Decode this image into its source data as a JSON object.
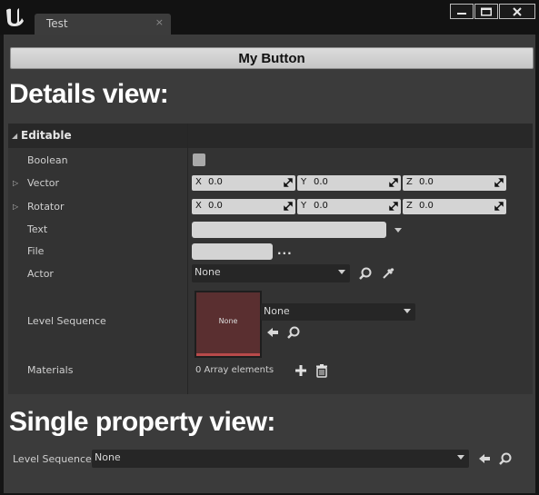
{
  "window": {
    "tab_title": "Test",
    "tab_close": "×"
  },
  "toolbar": {
    "my_button_label": "My Button"
  },
  "headings": {
    "details_view": "Details view:",
    "single_property_view": "Single property view:"
  },
  "details": {
    "category": "Editable",
    "rows": {
      "boolean": "Boolean",
      "vector": "Vector",
      "rotator": "Rotator",
      "text": "Text",
      "file": "File",
      "actor": "Actor",
      "level_sequence": "Level Sequence",
      "materials": "Materials"
    },
    "vector": {
      "x_axis": "X",
      "x_value": "0.0",
      "y_axis": "Y",
      "y_value": "0.0",
      "z_axis": "Z",
      "z_value": "0.0"
    },
    "rotator": {
      "x_axis": "X",
      "x_value": "0.0",
      "y_axis": "Y",
      "y_value": "0.0",
      "z_axis": "Z",
      "z_value": "0.0"
    },
    "file_browse": "...",
    "actor_value": "None",
    "level_sequence_thumb": "None",
    "level_sequence_value": "None",
    "materials_value": "0 Array elements"
  },
  "single_property": {
    "label": "Level Sequence",
    "value": "None"
  },
  "colors": {
    "content_bg": "#3b3b3b",
    "button_bg": "#d0d0d0",
    "heading_text": "#ffffff",
    "thumbnail_bg": "#5a2f30"
  }
}
